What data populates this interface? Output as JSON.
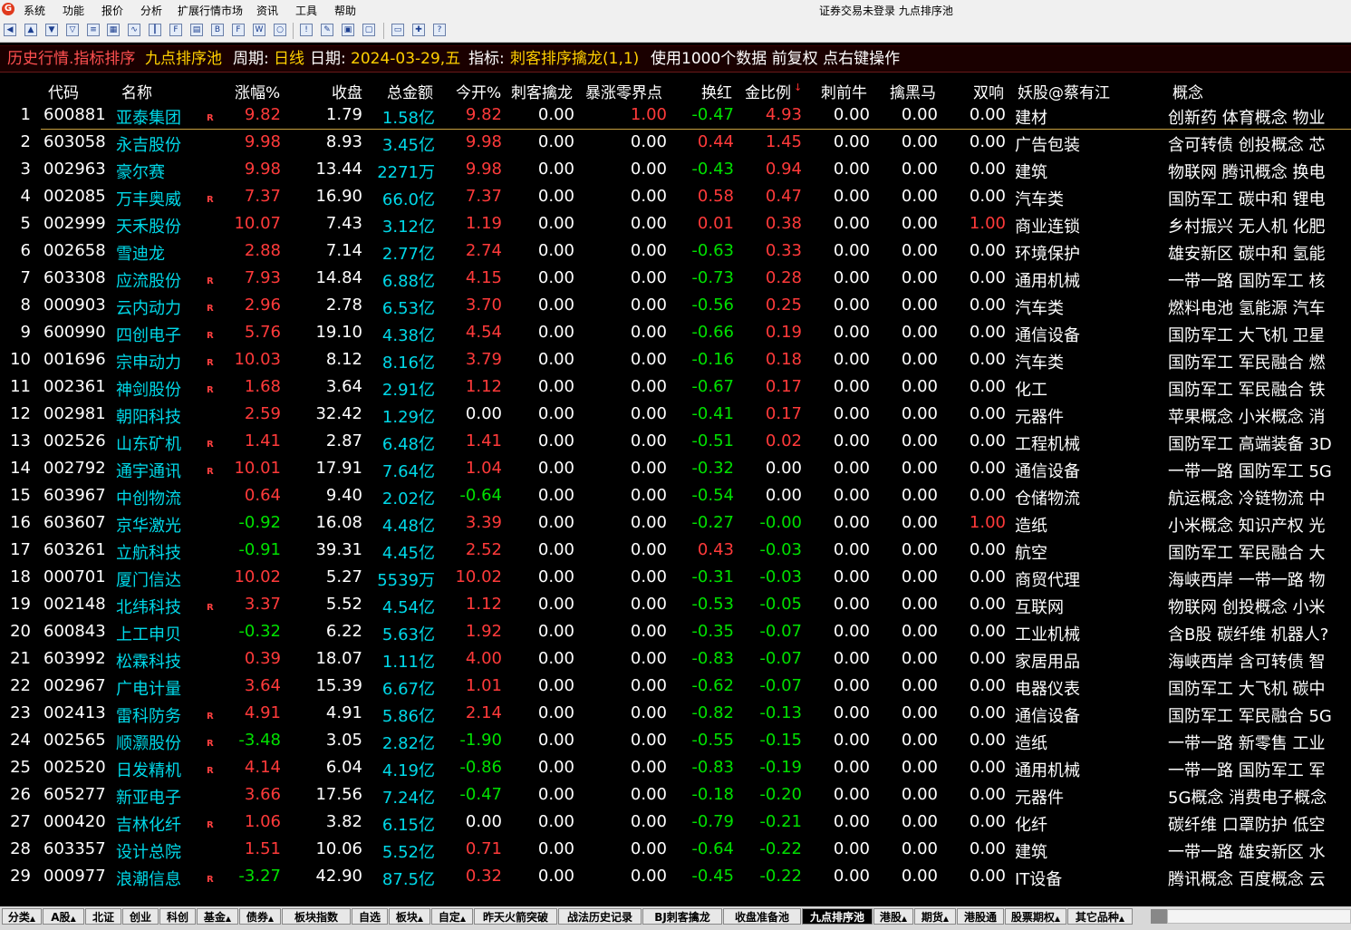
{
  "window": {
    "title": "证券交易未登录  九点排序池"
  },
  "menu": [
    "系统",
    "功能",
    "报价",
    "分析",
    "扩展行情市场",
    "资讯",
    "工具",
    "帮助"
  ],
  "toolbar_icons": [
    "back-arrow-icon",
    "forward-arrow-icon",
    "up-arrow-icon",
    "down-arrow-icon",
    "quote-list-icon",
    "grid-icon",
    "report-icon",
    "line-chart-icon",
    "candle-chart-icon",
    "f10-icon",
    "f9-icon",
    "f11-icon",
    "f12-icon",
    "f10b-icon",
    "f30-icon",
    "window-icon",
    "warning-icon",
    "edit-icon",
    "calc-icon",
    "print-icon",
    "folder-icon",
    "tools-icon",
    "help-icon"
  ],
  "infobar": {
    "title": "历史行情.指标排序",
    "pool": "九点排序池",
    "period_label": "周期:",
    "period": "日线",
    "date_label": "日期:",
    "date": "2024-03-29,五",
    "indicator_label": "指标:",
    "indicator": "刺客排序擒龙(1,1)",
    "note": "使用1000个数据 前复权 点右键操作"
  },
  "columns": [
    "代码",
    "名称",
    "涨幅%",
    "收盘",
    "总金额",
    "今开%",
    "刺客擒龙",
    "暴涨零界点",
    "换红",
    "金比例",
    "刺前牛",
    "擒黑马",
    "双响",
    "妖股@蔡有江",
    "概念"
  ],
  "rows": [
    {
      "n": "1",
      "code": "600881",
      "name": "亚泰集团",
      "r": true,
      "chg": "9.82",
      "close": "1.79",
      "amt": "1.58亿",
      "open": "9.82",
      "ck": "0.00",
      "bz": "1.00",
      "hh": "-0.47",
      "jb": "4.93",
      "cq": "0.00",
      "qh": "0.00",
      "sx": "0.00",
      "ind": "建材",
      "concept": "创新药 体育概念 物业"
    },
    {
      "n": "2",
      "code": "603058",
      "name": "永吉股份",
      "r": false,
      "chg": "9.98",
      "close": "8.93",
      "amt": "3.45亿",
      "open": "9.98",
      "ck": "0.00",
      "bz": "0.00",
      "hh": "0.44",
      "jb": "1.45",
      "cq": "0.00",
      "qh": "0.00",
      "sx": "0.00",
      "ind": "广告包装",
      "concept": "含可转债 创投概念 芯"
    },
    {
      "n": "3",
      "code": "002963",
      "name": "豪尔赛",
      "r": false,
      "chg": "9.98",
      "close": "13.44",
      "amt": "2271万",
      "open": "9.98",
      "ck": "0.00",
      "bz": "0.00",
      "hh": "-0.43",
      "jb": "0.94",
      "cq": "0.00",
      "qh": "0.00",
      "sx": "0.00",
      "ind": "建筑",
      "concept": "物联网 腾讯概念 换电"
    },
    {
      "n": "4",
      "code": "002085",
      "name": "万丰奥威",
      "r": true,
      "chg": "7.37",
      "close": "16.90",
      "amt": "66.0亿",
      "open": "7.37",
      "ck": "0.00",
      "bz": "0.00",
      "hh": "0.58",
      "jb": "0.47",
      "cq": "0.00",
      "qh": "0.00",
      "sx": "0.00",
      "ind": "汽车类",
      "concept": "国防军工 碳中和 锂电"
    },
    {
      "n": "5",
      "code": "002999",
      "name": "天禾股份",
      "r": false,
      "chg": "10.07",
      "close": "7.43",
      "amt": "3.12亿",
      "open": "1.19",
      "ck": "0.00",
      "bz": "0.00",
      "hh": "0.01",
      "jb": "0.38",
      "cq": "0.00",
      "qh": "0.00",
      "sx": "1.00",
      "ind": "商业连锁",
      "concept": "乡村振兴 无人机 化肥"
    },
    {
      "n": "6",
      "code": "002658",
      "name": "雪迪龙",
      "r": false,
      "chg": "2.88",
      "close": "7.14",
      "amt": "2.77亿",
      "open": "2.74",
      "ck": "0.00",
      "bz": "0.00",
      "hh": "-0.63",
      "jb": "0.33",
      "cq": "0.00",
      "qh": "0.00",
      "sx": "0.00",
      "ind": "环境保护",
      "concept": "雄安新区 碳中和 氢能"
    },
    {
      "n": "7",
      "code": "603308",
      "name": "应流股份",
      "r": true,
      "chg": "7.93",
      "close": "14.84",
      "amt": "6.88亿",
      "open": "4.15",
      "ck": "0.00",
      "bz": "0.00",
      "hh": "-0.73",
      "jb": "0.28",
      "cq": "0.00",
      "qh": "0.00",
      "sx": "0.00",
      "ind": "通用机械",
      "concept": "一带一路 国防军工 核"
    },
    {
      "n": "8",
      "code": "000903",
      "name": "云内动力",
      "r": true,
      "chg": "2.96",
      "close": "2.78",
      "amt": "6.53亿",
      "open": "3.70",
      "ck": "0.00",
      "bz": "0.00",
      "hh": "-0.56",
      "jb": "0.25",
      "cq": "0.00",
      "qh": "0.00",
      "sx": "0.00",
      "ind": "汽车类",
      "concept": "燃料电池 氢能源 汽车"
    },
    {
      "n": "9",
      "code": "600990",
      "name": "四创电子",
      "r": true,
      "chg": "5.76",
      "close": "19.10",
      "amt": "4.38亿",
      "open": "4.54",
      "ck": "0.00",
      "bz": "0.00",
      "hh": "-0.66",
      "jb": "0.19",
      "cq": "0.00",
      "qh": "0.00",
      "sx": "0.00",
      "ind": "通信设备",
      "concept": "国防军工 大飞机 卫星"
    },
    {
      "n": "10",
      "code": "001696",
      "name": "宗申动力",
      "r": true,
      "chg": "10.03",
      "close": "8.12",
      "amt": "8.16亿",
      "open": "3.79",
      "ck": "0.00",
      "bz": "0.00",
      "hh": "-0.16",
      "jb": "0.18",
      "cq": "0.00",
      "qh": "0.00",
      "sx": "0.00",
      "ind": "汽车类",
      "concept": "国防军工 军民融合 燃"
    },
    {
      "n": "11",
      "code": "002361",
      "name": "神剑股份",
      "r": true,
      "chg": "1.68",
      "close": "3.64",
      "amt": "2.91亿",
      "open": "1.12",
      "ck": "0.00",
      "bz": "0.00",
      "hh": "-0.67",
      "jb": "0.17",
      "cq": "0.00",
      "qh": "0.00",
      "sx": "0.00",
      "ind": "化工",
      "concept": "国防军工 军民融合 铁"
    },
    {
      "n": "12",
      "code": "002981",
      "name": "朝阳科技",
      "r": false,
      "chg": "2.59",
      "close": "32.42",
      "amt": "1.29亿",
      "open": "0.00",
      "ck": "0.00",
      "bz": "0.00",
      "hh": "-0.41",
      "jb": "0.17",
      "cq": "0.00",
      "qh": "0.00",
      "sx": "0.00",
      "ind": "元器件",
      "concept": "苹果概念 小米概念 消"
    },
    {
      "n": "13",
      "code": "002526",
      "name": "山东矿机",
      "r": true,
      "chg": "1.41",
      "close": "2.87",
      "amt": "6.48亿",
      "open": "1.41",
      "ck": "0.00",
      "bz": "0.00",
      "hh": "-0.51",
      "jb": "0.02",
      "cq": "0.00",
      "qh": "0.00",
      "sx": "0.00",
      "ind": "工程机械",
      "concept": "国防军工 高端装备 3D"
    },
    {
      "n": "14",
      "code": "002792",
      "name": "通宇通讯",
      "r": true,
      "chg": "10.01",
      "close": "17.91",
      "amt": "7.64亿",
      "open": "1.04",
      "ck": "0.00",
      "bz": "0.00",
      "hh": "-0.32",
      "jb": "0.00",
      "cq": "0.00",
      "qh": "0.00",
      "sx": "0.00",
      "ind": "通信设备",
      "concept": "一带一路 国防军工 5G"
    },
    {
      "n": "15",
      "code": "603967",
      "name": "中创物流",
      "r": false,
      "chg": "0.64",
      "close": "9.40",
      "amt": "2.02亿",
      "open": "-0.64",
      "ck": "0.00",
      "bz": "0.00",
      "hh": "-0.54",
      "jb": "0.00",
      "cq": "0.00",
      "qh": "0.00",
      "sx": "0.00",
      "ind": "仓储物流",
      "concept": "航运概念 冷链物流 中"
    },
    {
      "n": "16",
      "code": "603607",
      "name": "京华激光",
      "r": false,
      "chg": "-0.92",
      "close": "16.08",
      "amt": "4.48亿",
      "open": "3.39",
      "ck": "0.00",
      "bz": "0.00",
      "hh": "-0.27",
      "jb": "-0.00",
      "cq": "0.00",
      "qh": "0.00",
      "sx": "1.00",
      "ind": "造纸",
      "concept": "小米概念 知识产权 光"
    },
    {
      "n": "17",
      "code": "603261",
      "name": "立航科技",
      "r": false,
      "chg": "-0.91",
      "close": "39.31",
      "amt": "4.45亿",
      "open": "2.52",
      "ck": "0.00",
      "bz": "0.00",
      "hh": "0.43",
      "jb": "-0.03",
      "cq": "0.00",
      "qh": "0.00",
      "sx": "0.00",
      "ind": "航空",
      "concept": "国防军工 军民融合 大"
    },
    {
      "n": "18",
      "code": "000701",
      "name": "厦门信达",
      "r": false,
      "chg": "10.02",
      "close": "5.27",
      "amt": "5539万",
      "open": "10.02",
      "ck": "0.00",
      "bz": "0.00",
      "hh": "-0.31",
      "jb": "-0.03",
      "cq": "0.00",
      "qh": "0.00",
      "sx": "0.00",
      "ind": "商贸代理",
      "concept": "海峡西岸 一带一路 物"
    },
    {
      "n": "19",
      "code": "002148",
      "name": "北纬科技",
      "r": true,
      "chg": "3.37",
      "close": "5.52",
      "amt": "4.54亿",
      "open": "1.12",
      "ck": "0.00",
      "bz": "0.00",
      "hh": "-0.53",
      "jb": "-0.05",
      "cq": "0.00",
      "qh": "0.00",
      "sx": "0.00",
      "ind": "互联网",
      "concept": "物联网 创投概念 小米"
    },
    {
      "n": "20",
      "code": "600843",
      "name": "上工申贝",
      "r": false,
      "chg": "-0.32",
      "close": "6.22",
      "amt": "5.63亿",
      "open": "1.92",
      "ck": "0.00",
      "bz": "0.00",
      "hh": "-0.35",
      "jb": "-0.07",
      "cq": "0.00",
      "qh": "0.00",
      "sx": "0.00",
      "ind": "工业机械",
      "concept": "含B股 碳纤维 机器人?"
    },
    {
      "n": "21",
      "code": "603992",
      "name": "松霖科技",
      "r": false,
      "chg": "0.39",
      "close": "18.07",
      "amt": "1.11亿",
      "open": "4.00",
      "ck": "0.00",
      "bz": "0.00",
      "hh": "-0.83",
      "jb": "-0.07",
      "cq": "0.00",
      "qh": "0.00",
      "sx": "0.00",
      "ind": "家居用品",
      "concept": "海峡西岸 含可转债 智"
    },
    {
      "n": "22",
      "code": "002967",
      "name": "广电计量",
      "r": false,
      "chg": "3.64",
      "close": "15.39",
      "amt": "6.67亿",
      "open": "1.01",
      "ck": "0.00",
      "bz": "0.00",
      "hh": "-0.62",
      "jb": "-0.07",
      "cq": "0.00",
      "qh": "0.00",
      "sx": "0.00",
      "ind": "电器仪表",
      "concept": "国防军工 大飞机 碳中"
    },
    {
      "n": "23",
      "code": "002413",
      "name": "雷科防务",
      "r": true,
      "chg": "4.91",
      "close": "4.91",
      "amt": "5.86亿",
      "open": "2.14",
      "ck": "0.00",
      "bz": "0.00",
      "hh": "-0.82",
      "jb": "-0.13",
      "cq": "0.00",
      "qh": "0.00",
      "sx": "0.00",
      "ind": "通信设备",
      "concept": "国防军工 军民融合 5G"
    },
    {
      "n": "24",
      "code": "002565",
      "name": "顺灏股份",
      "r": true,
      "chg": "-3.48",
      "close": "3.05",
      "amt": "2.82亿",
      "open": "-1.90",
      "ck": "0.00",
      "bz": "0.00",
      "hh": "-0.55",
      "jb": "-0.15",
      "cq": "0.00",
      "qh": "0.00",
      "sx": "0.00",
      "ind": "造纸",
      "concept": "一带一路 新零售 工业"
    },
    {
      "n": "25",
      "code": "002520",
      "name": "日发精机",
      "r": true,
      "chg": "4.14",
      "close": "6.04",
      "amt": "4.19亿",
      "open": "-0.86",
      "ck": "0.00",
      "bz": "0.00",
      "hh": "-0.83",
      "jb": "-0.19",
      "cq": "0.00",
      "qh": "0.00",
      "sx": "0.00",
      "ind": "通用机械",
      "concept": "一带一路 国防军工 军"
    },
    {
      "n": "26",
      "code": "605277",
      "name": "新亚电子",
      "r": false,
      "chg": "3.66",
      "close": "17.56",
      "amt": "7.24亿",
      "open": "-0.47",
      "ck": "0.00",
      "bz": "0.00",
      "hh": "-0.18",
      "jb": "-0.20",
      "cq": "0.00",
      "qh": "0.00",
      "sx": "0.00",
      "ind": "元器件",
      "concept": "5G概念 消费电子概念"
    },
    {
      "n": "27",
      "code": "000420",
      "name": "吉林化纤",
      "r": true,
      "chg": "1.06",
      "close": "3.82",
      "amt": "6.15亿",
      "open": "0.00",
      "ck": "0.00",
      "bz": "0.00",
      "hh": "-0.79",
      "jb": "-0.21",
      "cq": "0.00",
      "qh": "0.00",
      "sx": "0.00",
      "ind": "化纤",
      "concept": "碳纤维 口罩防护 低空"
    },
    {
      "n": "28",
      "code": "603357",
      "name": "设计总院",
      "r": false,
      "chg": "1.51",
      "close": "10.06",
      "amt": "5.52亿",
      "open": "0.71",
      "ck": "0.00",
      "bz": "0.00",
      "hh": "-0.64",
      "jb": "-0.22",
      "cq": "0.00",
      "qh": "0.00",
      "sx": "0.00",
      "ind": "建筑",
      "concept": "一带一路 雄安新区 水"
    },
    {
      "n": "29",
      "code": "000977",
      "name": "浪潮信息",
      "r": true,
      "chg": "-3.27",
      "close": "42.90",
      "amt": "87.5亿",
      "open": "0.32",
      "ck": "0.00",
      "bz": "0.00",
      "hh": "-0.45",
      "jb": "-0.22",
      "cq": "0.00",
      "qh": "0.00",
      "sx": "0.00",
      "ind": "IT设备",
      "concept": "腾讯概念 百度概念 云"
    }
  ],
  "r_flag": "R",
  "tabs": [
    {
      "label": "分类",
      "arrow": "▲"
    },
    {
      "label": "A股",
      "arrow": "▲"
    },
    {
      "label": "北证",
      "arrow": ""
    },
    {
      "label": "创业",
      "arrow": ""
    },
    {
      "label": "科创",
      "arrow": ""
    },
    {
      "label": "基金",
      "arrow": "▲"
    },
    {
      "label": "债券",
      "arrow": "▲"
    },
    {
      "label": "板块指数",
      "arrow": ""
    },
    {
      "label": "自选",
      "arrow": ""
    },
    {
      "label": "板块",
      "arrow": "▲"
    },
    {
      "label": "自定",
      "arrow": "▲"
    },
    {
      "label": "昨天火箭突破",
      "arrow": ""
    },
    {
      "label": "战法历史记录",
      "arrow": ""
    },
    {
      "label": "BJ刺客擒龙",
      "arrow": ""
    },
    {
      "label": "收盘准备池",
      "arrow": ""
    },
    {
      "label": "九点排序池",
      "arrow": "",
      "active": true
    },
    {
      "label": "港股",
      "arrow": "▲"
    },
    {
      "label": "期货",
      "arrow": "▲"
    },
    {
      "label": "港股通",
      "arrow": ""
    },
    {
      "label": "股票期权",
      "arrow": "▲"
    },
    {
      "label": "其它品种",
      "arrow": "▲"
    }
  ],
  "colors": {
    "up": "#ff3a3a",
    "down": "#00e000",
    "neutral": "#ffffff",
    "code": "#ffffff",
    "name": "#00d8e8",
    "amount": "#00d8e8",
    "title_accent": "#ffd000",
    "title_red": "#ff5050"
  }
}
